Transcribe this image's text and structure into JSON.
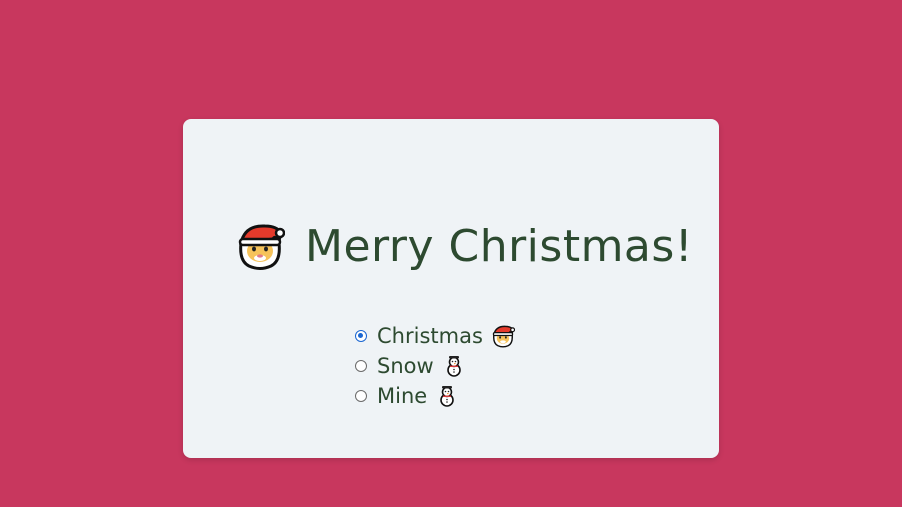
{
  "page": {
    "background_color": "#c8375e",
    "card_color": "#eff3f6",
    "text_color": "#2d4a30",
    "accent_color": "#1a66d1"
  },
  "heading": {
    "icon": "santa-icon",
    "title": "Merry Christmas!"
  },
  "options": [
    {
      "label": "Christmas",
      "icon": "santa-icon",
      "selected": true
    },
    {
      "label": "Snow",
      "icon": "snowman-icon",
      "selected": false
    },
    {
      "label": "Mine",
      "icon": "snowman-icon",
      "selected": false
    }
  ]
}
